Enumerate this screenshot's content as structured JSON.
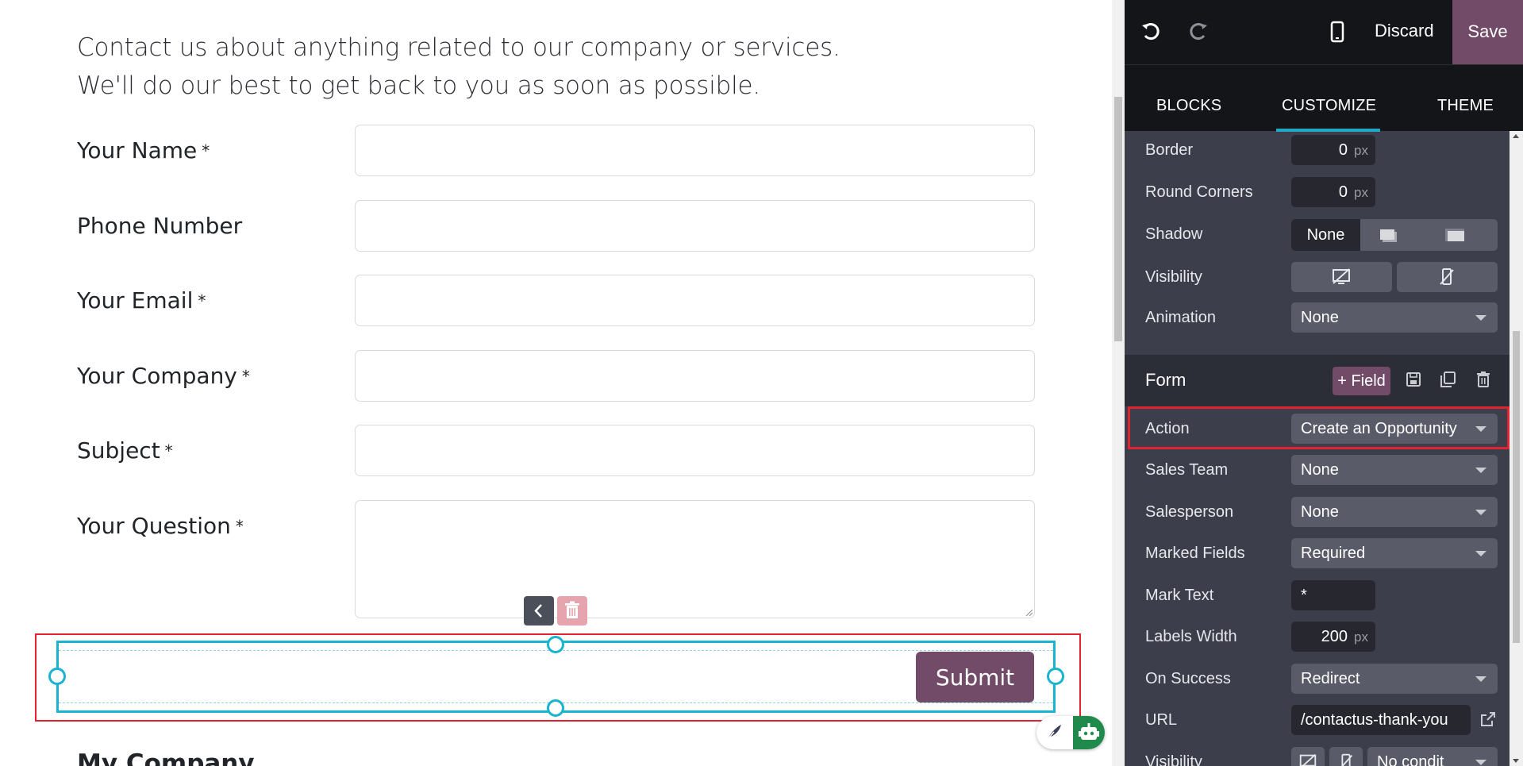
{
  "preview": {
    "intro_line1": "Contact us about anything related to our company or services.",
    "intro_line2": "We'll do our best to get back to you as soon as possible.",
    "fields": [
      {
        "label": "Your Name",
        "required_mark": "*"
      },
      {
        "label": "Phone Number",
        "required_mark": ""
      },
      {
        "label": "Your Email",
        "required_mark": "*"
      },
      {
        "label": "Your Company",
        "required_mark": "*"
      },
      {
        "label": "Subject",
        "required_mark": "*"
      },
      {
        "label": "Your Question",
        "required_mark": "*"
      }
    ],
    "submit_label": "Submit",
    "company_heading": "My Company"
  },
  "toolbar": {
    "discard_label": "Discard",
    "save_label": "Save"
  },
  "tabs": {
    "blocks": "BLOCKS",
    "customize": "CUSTOMIZE",
    "theme": "THEME",
    "active": "CUSTOMIZE"
  },
  "style_options": {
    "border_label": "Border",
    "border_value": "0",
    "border_unit": "px",
    "round_corners_label": "Round Corners",
    "round_corners_value": "0",
    "round_corners_unit": "px",
    "shadow_label": "Shadow",
    "shadow_none": "None",
    "visibility_label": "Visibility",
    "animation_label": "Animation",
    "animation_value": "None"
  },
  "form_options": {
    "title": "Form",
    "add_field_label": "+ Field",
    "action_label": "Action",
    "action_value": "Create an Opportunity",
    "sales_team_label": "Sales Team",
    "sales_team_value": "None",
    "salesperson_label": "Salesperson",
    "salesperson_value": "None",
    "marked_fields_label": "Marked Fields",
    "marked_fields_value": "Required",
    "mark_text_label": "Mark Text",
    "mark_text_value": "*",
    "labels_width_label": "Labels Width",
    "labels_width_value": "200",
    "labels_width_unit": "px",
    "on_success_label": "On Success",
    "on_success_value": "Redirect",
    "url_label": "URL",
    "url_value": "/contactus-thank-you",
    "visibility_label": "Visibility",
    "visibility_value": "No condit"
  },
  "colors": {
    "brand": "#714b67",
    "selection": "#19b4cf",
    "highlight": "#e0232f",
    "panel_bg": "#3c3e4b"
  },
  "icons": [
    "undo-icon",
    "redo-icon",
    "mobile-icon",
    "chevron-left-icon",
    "trash-icon",
    "save-icon",
    "copy-icon",
    "external-link-icon",
    "feather-icon",
    "bot-icon"
  ]
}
